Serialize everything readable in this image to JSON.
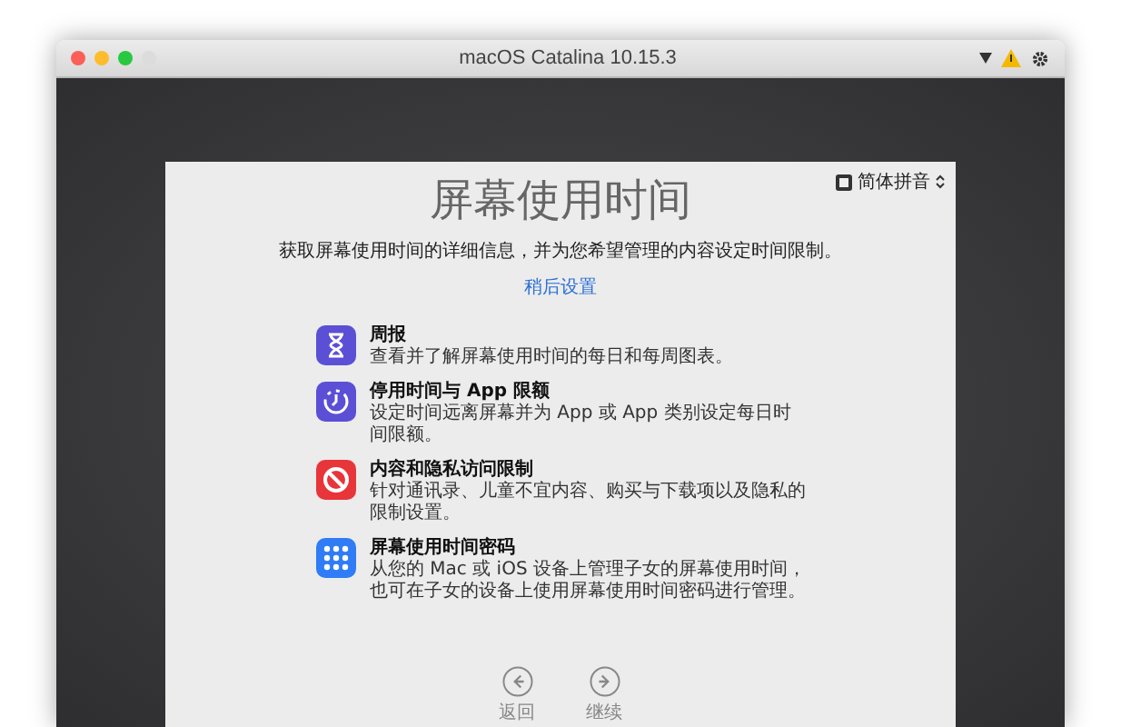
{
  "window": {
    "title": "macOS Catalina 10.15.3"
  },
  "input_menu": {
    "label": "简体拼音"
  },
  "title": "屏幕使用时间",
  "subtitle": "获取屏幕使用时间的详细信息，并为您希望管理的内容设定时间限制。",
  "later_link": "稍后设置",
  "features": [
    {
      "kind": "hourglass",
      "title": "周报",
      "description": "查看并了解屏幕使用时间的每日和每周图表。"
    },
    {
      "kind": "downtime",
      "title": "停用时间与 App 限额",
      "description": "设定时间远离屏幕并为 App 或 App 类别设定每日时间限额。"
    },
    {
      "kind": "restrict",
      "title": "内容和隐私访问限制",
      "description": "针对通讯录、儿童不宜内容、购买与下载项以及隐私的限制设置。"
    },
    {
      "kind": "passcode",
      "title": "屏幕使用时间密码",
      "description": "从您的 Mac 或 iOS 设备上管理子女的屏幕使用时间，也可在子女的设备上使用屏幕使用时间密码进行管理。"
    }
  ],
  "nav": [
    {
      "kind": "back",
      "label": "返回"
    },
    {
      "kind": "forward",
      "label": "继续"
    }
  ]
}
